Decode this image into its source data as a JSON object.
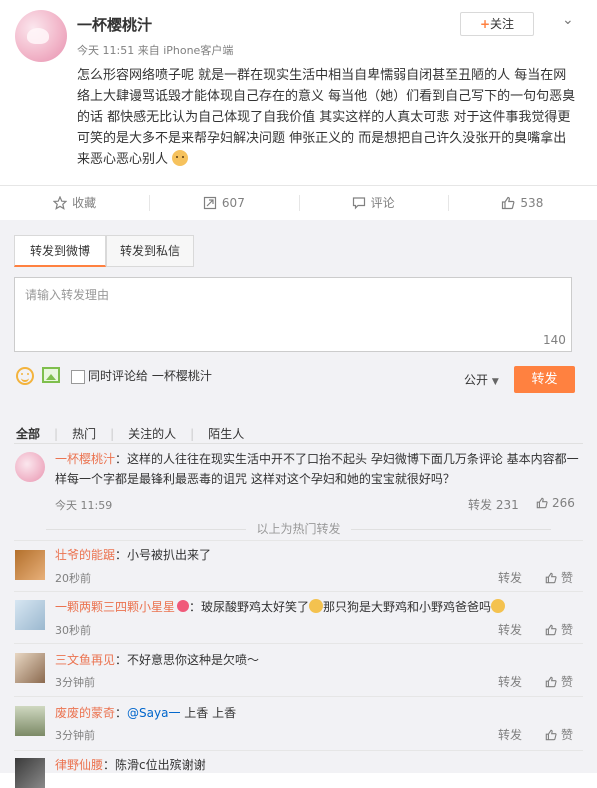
{
  "post": {
    "author": "一杯樱桃汁",
    "meta": "今天 11:51 来自 iPhone客户端",
    "follow_label": "关注",
    "text": "怎么形容网络喷子呢 就是一群在现实生活中相当自卑懦弱自闭甚至丑陋的人 每当在网络上大肆谩骂诋毁才能体现自己存在的意义 每当他（她）们看到自己写下的一句句恶臭的话 都快感无比认为自己体现了自我价值 其实这样的人真太可悲 对于这件事我觉得更可笑的是大多不是来帮孕妇解决问题 伸张正义的 而是想把自己许久没张开的臭嘴拿出来恶心恶心别人"
  },
  "actions": [
    {
      "name": "favorite",
      "label": "收藏",
      "icon": "star-icon"
    },
    {
      "name": "repost",
      "label": "607",
      "icon": "repost-icon"
    },
    {
      "name": "comment",
      "label": "评论",
      "icon": "comment-icon"
    },
    {
      "name": "like",
      "label": "538",
      "icon": "thumb-up-icon"
    }
  ],
  "repost_panel": {
    "tab_weibo": "转发到微博",
    "tab_private": "转发到私信",
    "placeholder": "请输入转发理由",
    "char_count": "140",
    "also_comment_label": "同时评论给 一杯樱桃汁",
    "visibility": "公开",
    "submit_label": "转发"
  },
  "filters": {
    "all": "全部",
    "hot": "热门",
    "following": "关注的人",
    "strangers": "陌生人"
  },
  "hot_divider": "以上为热门转发",
  "comments": [
    {
      "name": "一杯樱桃汁",
      "text": "：这样的人往往在现实生活中开不了口抬不起头 孕妇微博下面几万条评论 基本内容都一样每一个字都是最锋利最恶毒的诅咒 这样对这个孕妇和她的宝宝就很好吗？",
      "time": "今天 11:59",
      "repost": "转发 231",
      "like": "266"
    },
    {
      "name": "壮爷的能踞",
      "text": "：小号被扒出来了",
      "time": "20秒前",
      "repost": "转发",
      "like": "赞"
    },
    {
      "name": "一颗两颗三四颗小星星",
      "text_a": "：玻尿酸野鸡太好笑了",
      "text_b": "那只狗是大野鸡和小野鸡爸爸吗",
      "time": "30秒前",
      "repost": "转发",
      "like": "赞"
    },
    {
      "name": "三文鱼再见",
      "text": "：不好意思你这种是欠喷～",
      "time": "3分钟前",
      "repost": "转发",
      "like": "赞"
    },
    {
      "name": "废废的蒙奇",
      "mention": "@Saya一",
      "text": " 上香 上香",
      "time": "3分钟前",
      "repost": "转发",
      "like": "赞"
    },
    {
      "name": "律野仙腰",
      "text": "：陈滑c位出殡谢谢"
    }
  ]
}
